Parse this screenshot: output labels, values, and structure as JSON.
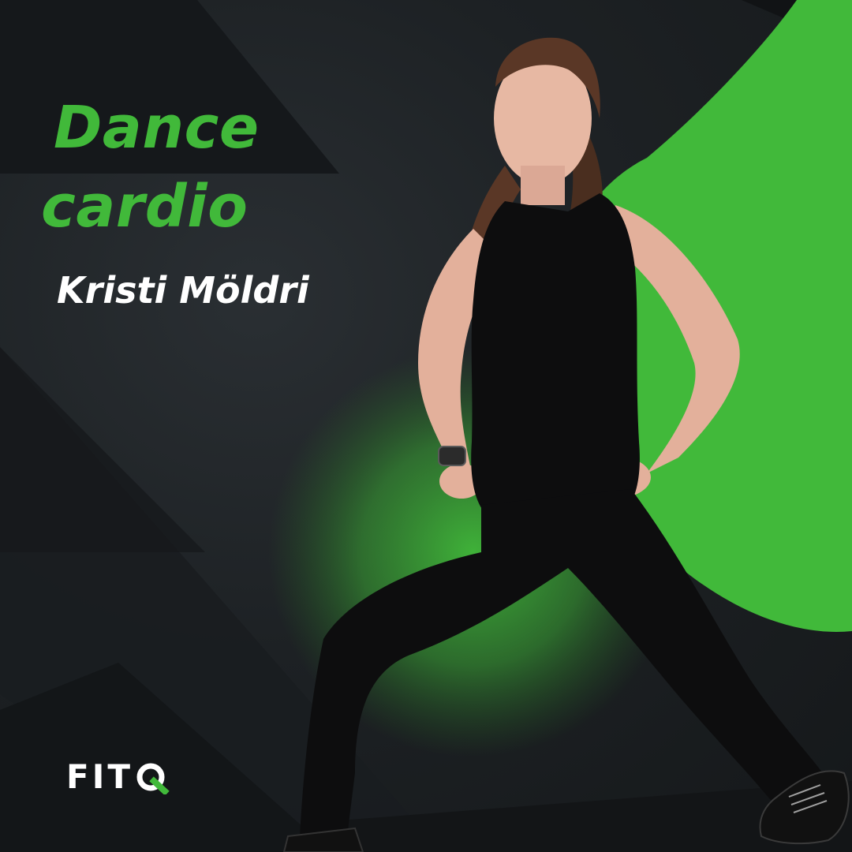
{
  "headline": {
    "line_1": "Dance",
    "line_2": "cardio"
  },
  "instructor_name": "Kristi Möldri",
  "brand": {
    "logo_text": "FIT",
    "logo_mark_icon": "q-letter-icon",
    "logo_label": "FITQ"
  },
  "colors": {
    "accent_green": "#41b93a",
    "background_dark": "#1b1f22",
    "text_white": "#ffffff",
    "outfit_black": "#0d0d0e"
  },
  "photo": {
    "subject_icon": "woman-lunge-photo"
  }
}
